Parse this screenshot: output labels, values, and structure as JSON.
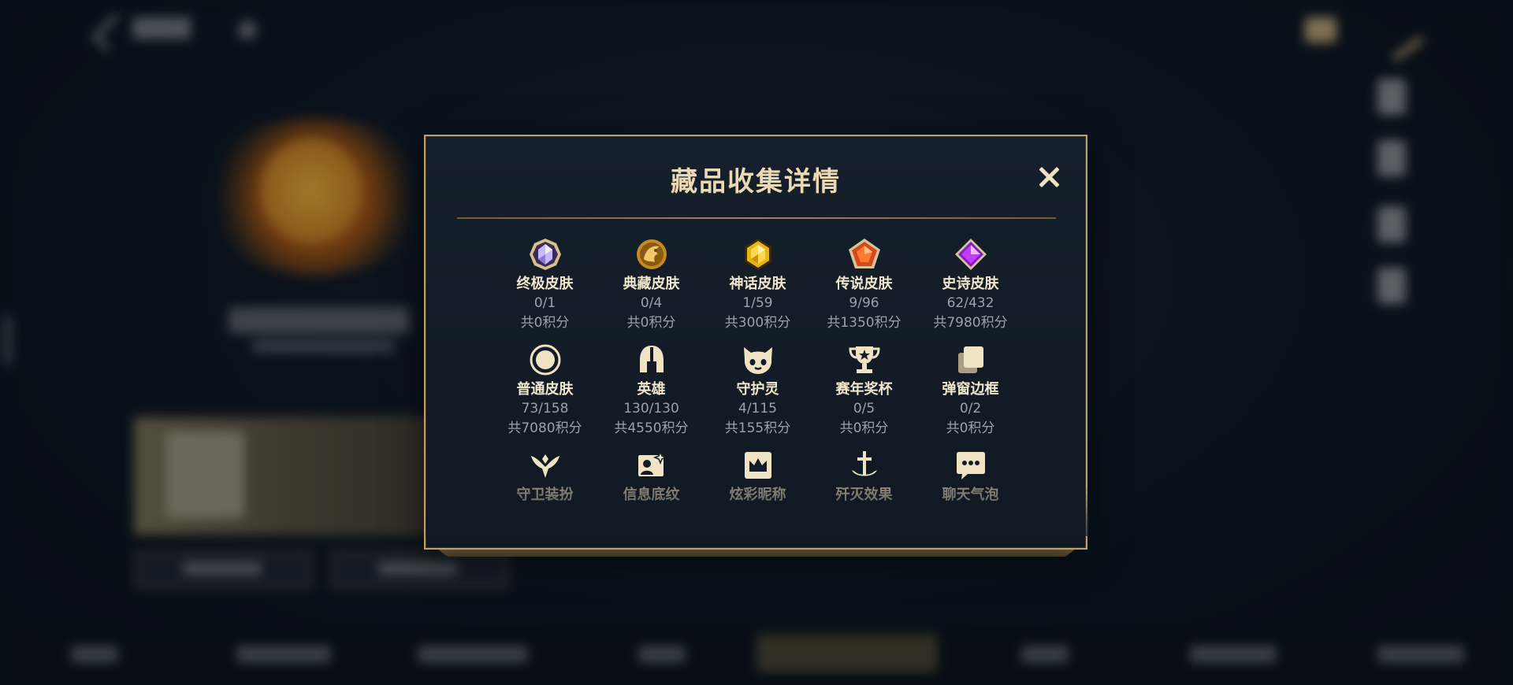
{
  "modal": {
    "title": "藏品收集详情",
    "close_label": "×"
  },
  "collection": [
    {
      "name": "终极皮肤",
      "count": "0/1",
      "points": "共0积分",
      "icon": "ultimate-skin-icon"
    },
    {
      "name": "典藏皮肤",
      "count": "0/4",
      "points": "共0积分",
      "icon": "prestige-skin-icon"
    },
    {
      "name": "神话皮肤",
      "count": "1/59",
      "points": "共300积分",
      "icon": "mythic-skin-icon"
    },
    {
      "name": "传说皮肤",
      "count": "9/96",
      "points": "共1350积分",
      "icon": "legendary-skin-icon"
    },
    {
      "name": "史诗皮肤",
      "count": "62/432",
      "points": "共7980积分",
      "icon": "epic-skin-icon"
    },
    {
      "name": "普通皮肤",
      "count": "73/158",
      "points": "共7080积分",
      "icon": "standard-skin-icon"
    },
    {
      "name": "英雄",
      "count": "130/130",
      "points": "共4550积分",
      "icon": "champion-helmet-icon"
    },
    {
      "name": "守护灵",
      "count": "4/115",
      "points": "共155积分",
      "icon": "guardian-spirit-icon"
    },
    {
      "name": "赛年奖杯",
      "count": "0/5",
      "points": "共0积分",
      "icon": "season-trophy-icon"
    },
    {
      "name": "弹窗边框",
      "count": "0/2",
      "points": "共0积分",
      "icon": "popup-frame-icon"
    },
    {
      "name": "守卫装扮",
      "icon": "ward-skin-icon"
    },
    {
      "name": "信息底纹",
      "icon": "profile-banner-icon"
    },
    {
      "name": "炫彩昵称",
      "icon": "colorful-nickname-icon"
    },
    {
      "name": "歼灭效果",
      "icon": "elimination-effect-icon"
    },
    {
      "name": "聊天气泡",
      "icon": "chat-bubble-icon"
    }
  ],
  "colors": {
    "gold_border": "#c3a06a",
    "title_text": "#ead9b2",
    "label_text": "#f0e6cd",
    "secondary_text": "#9aa2ab"
  }
}
